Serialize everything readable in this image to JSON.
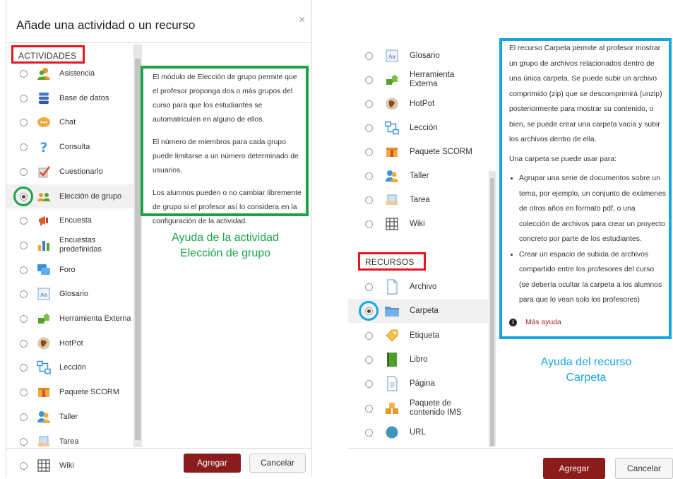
{
  "left": {
    "title": "Añade una actividad o un recurso",
    "close": "×",
    "header": "ACTIVIDADES",
    "items": [
      {
        "label": "Asistencia",
        "icon": "attendance-icon"
      },
      {
        "label": "Base de datos",
        "icon": "database-icon"
      },
      {
        "label": "Chat",
        "icon": "chat-icon"
      },
      {
        "label": "Consulta",
        "icon": "question-icon"
      },
      {
        "label": "Cuestionario",
        "icon": "quiz-icon"
      },
      {
        "label": "Elección de grupo",
        "icon": "group-choice-icon"
      },
      {
        "label": "Encuesta",
        "icon": "megaphone-icon"
      },
      {
        "label": "Encuestas predefinidas",
        "icon": "bar-chart-icon"
      },
      {
        "label": "Foro",
        "icon": "forum-icon"
      },
      {
        "label": "Glosario",
        "icon": "glossary-icon"
      },
      {
        "label": "Herramienta Externa",
        "icon": "puzzle-icon"
      },
      {
        "label": "HotPot",
        "icon": "hotpot-icon"
      },
      {
        "label": "Lección",
        "icon": "lesson-icon"
      },
      {
        "label": "Paquete SCORM",
        "icon": "scorm-icon"
      },
      {
        "label": "Taller",
        "icon": "workshop-icon"
      },
      {
        "label": "Tarea",
        "icon": "assignment-icon"
      },
      {
        "label": "Wiki",
        "icon": "wiki-icon"
      }
    ],
    "help_paragraphs": [
      "El módulo de Elección de grupo permite que el profesor proponga dos o más grupos del curso para que los estudiantes se automatriculen en alguno de ellos.",
      "El número de miembros para cada grupo puede limitarse a un número determinado de usuarios.",
      "Los alumnos pueden o no cambiar libremente de grupo si el profesor así lo considera en la configuración de la actividad."
    ],
    "caption_line1": "Ayuda de la actividad",
    "caption_line2": "Elección de grupo",
    "add_button": "Agregar",
    "cancel_button": "Cancelar"
  },
  "right": {
    "activity_items": [
      {
        "label": "Glosario",
        "icon": "glossary-icon"
      },
      {
        "label": "Herramienta Externa",
        "icon": "puzzle-icon"
      },
      {
        "label": "HotPot",
        "icon": "hotpot-icon"
      },
      {
        "label": "Lección",
        "icon": "lesson-icon"
      },
      {
        "label": "Paquete SCORM",
        "icon": "scorm-icon"
      },
      {
        "label": "Taller",
        "icon": "workshop-icon"
      },
      {
        "label": "Tarea",
        "icon": "assignment-icon"
      },
      {
        "label": "Wiki",
        "icon": "wiki-icon"
      }
    ],
    "header": "RECURSOS",
    "resource_items": [
      {
        "label": "Archivo",
        "icon": "file-icon"
      },
      {
        "label": "Carpeta",
        "icon": "folder-icon"
      },
      {
        "label": "Etiqueta",
        "icon": "label-tag-icon"
      },
      {
        "label": "Libro",
        "icon": "book-icon"
      },
      {
        "label": "Página",
        "icon": "page-icon"
      },
      {
        "label": "Paquete de contenido IMS",
        "icon": "ims-package-icon"
      },
      {
        "label": "URL",
        "icon": "url-globe-icon"
      }
    ],
    "help_intro": "El recurso Carpeta permite al profesor mostrar un grupo de archivos relacionados dentro de una única carpeta. Se puede subir un archivo comprimido (zip) que se descomprimirá (unzip) posteriormente para mostrar su contenido, o bien, se puede crear una carpeta vacía y subir los archivos dentro de ella.",
    "help_uses": "Una carpeta se puede usar para:",
    "help_bullets": [
      "Agrupar una serie de documentos sobre un tema, por ejemplo, un conjunto de exámenes de otros años en formato pdf, o una colección de archivos para crear un proyecto concreto por parte de los estudiantes.",
      "Crear un espacio de subida de archivos compartido entre los profesores del curso (se debería ocultar la carpeta a los alumnos para que lo vean solo los profesores)"
    ],
    "more_help": "Más ayuda",
    "caption_line1": "Ayuda del recurso",
    "caption_line2": "Carpeta",
    "add_button": "Agregar",
    "cancel_button": "Cancelar"
  },
  "colors": {
    "red_highlight": "#e8141e",
    "green_highlight": "#1aa34a",
    "blue_highlight": "#19a6e0",
    "primary_button": "#8a1c1c",
    "more_help_link": "#b01c1c"
  }
}
